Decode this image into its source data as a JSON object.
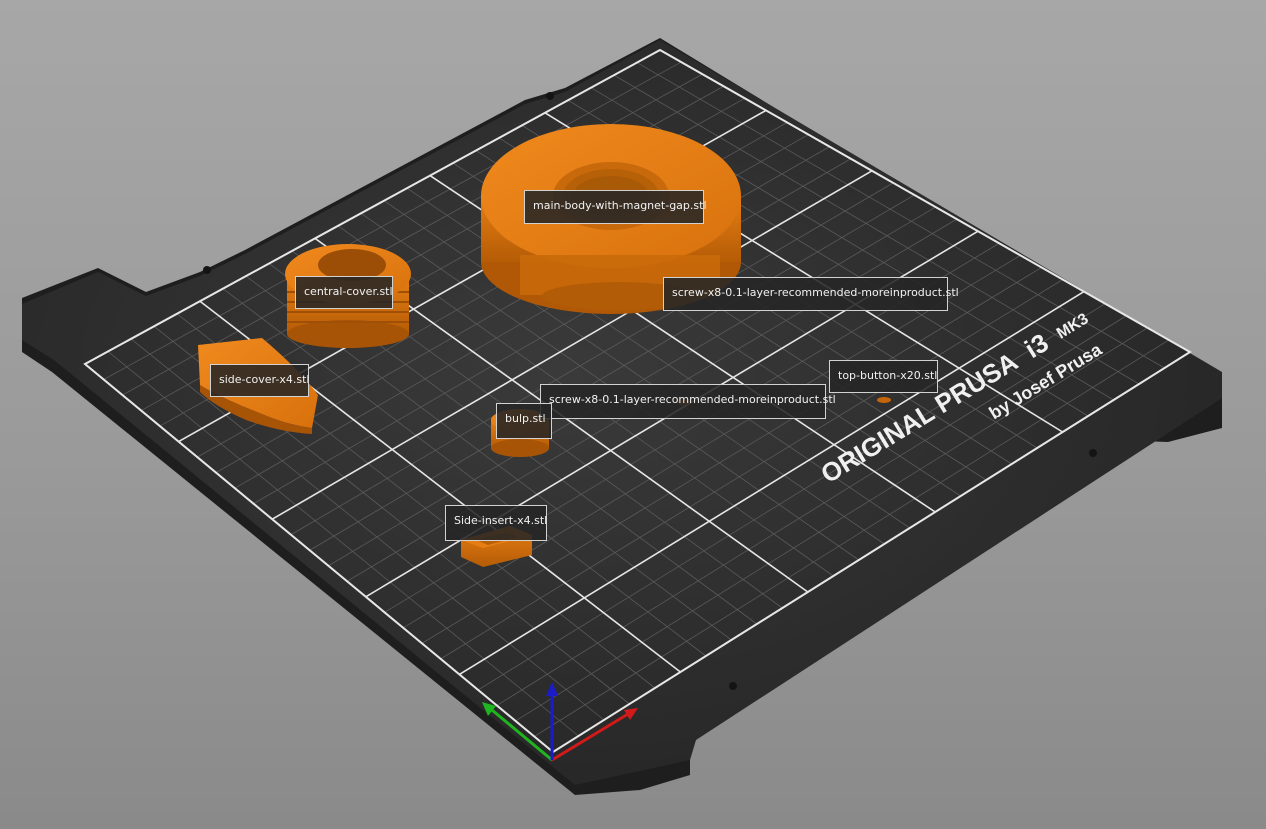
{
  "bed": {
    "brand_main": "ORIGINAL PRUSA",
    "brand_model": "i3",
    "brand_sub": "MK3",
    "brand_by": "by Josef Prusa"
  },
  "objects": {
    "main_body": "main-body-with-magnet-gap.stl",
    "screw_large": "screw-x8-0.1-layer-recommended-moreinproduct.stl",
    "central_cover": "central-cover.stl",
    "side_cover": "side-cover-x4.stl",
    "top_button": "top-button-x20.stl",
    "screw_small": "screw-x8-0.1-layer-recommended-moreinproduct.stl",
    "bulp": "bulp.stl",
    "side_insert": "Side-insert-x4.stl"
  },
  "colors": {
    "background": "#9c9c9c",
    "bed_surface": "#2c2c2c",
    "bed_edge": "#1d1d1d",
    "grid_line": "#5a5a5a",
    "grid_major": "#e6e6e6",
    "object_orange": "#e37b12",
    "object_orange_dark": "#b85f08",
    "axis_x": "#d21a1a",
    "axis_y": "#1fb51f",
    "axis_z": "#1b1bc8"
  }
}
